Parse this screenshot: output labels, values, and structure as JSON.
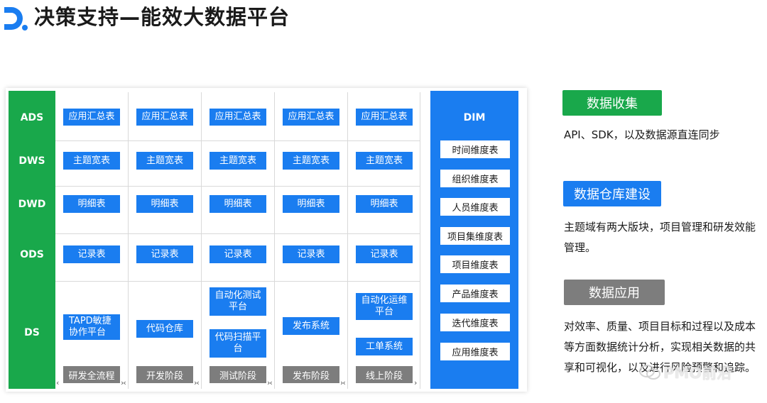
{
  "header": {
    "title": "决策支持—能效大数据平台"
  },
  "layers": [
    "ADS",
    "DWS",
    "DWD",
    "ODS",
    "DS"
  ],
  "grid": {
    "ads": [
      "应用汇总表",
      "应用汇总表",
      "应用汇总表",
      "应用汇总表",
      "应用汇总表"
    ],
    "dws": [
      "主题宽表",
      "主题宽表",
      "主题宽表",
      "主题宽表",
      "主题宽表"
    ],
    "dwd": [
      "明细表",
      "明细表",
      "明细表",
      "明细表",
      "明细表"
    ],
    "ods": [
      "记录表",
      "记录表",
      "记录表",
      "记录表",
      "记录表"
    ],
    "ds": {
      "col1": "TAPD敏捷协作平台",
      "col2": "代码仓库",
      "col3a": "自动化测试平台",
      "col3b": "代码扫描平台",
      "col4": "发布系统",
      "col5a": "自动化运维平台",
      "col5b": "工单系统"
    }
  },
  "stages": [
    "研发全流程",
    "开发阶段",
    "测试阶段",
    "发布阶段",
    "线上阶段"
  ],
  "dim": {
    "title": "DIM",
    "items": [
      "时间维度表",
      "组织维度表",
      "人员维度表",
      "项目集维度表",
      "项目维度表",
      "产品维度表",
      "迭代维度表",
      "应用维度表"
    ]
  },
  "sections": [
    {
      "tag": "数据收集",
      "desc": "API、SDK，以及数据源直连同步",
      "color": "#19a84b"
    },
    {
      "tag": "数据仓库建设",
      "desc": "主题域有两大版块，项目管理和研发效能管理。",
      "color": "#1a7df0"
    },
    {
      "tag": "数据应用",
      "desc": "对效率、质量、项目目标和过程以及成本等方面数据统计分析，实现相关数据的共享和可视化，以及进行风险预警和追踪。",
      "color": "#7d7d7d"
    }
  ],
  "watermark": {
    "text": "PMO前沿"
  },
  "colors": {
    "green": "#19a84b",
    "blue": "#1a7df0",
    "gray": "#7d7d7d"
  }
}
